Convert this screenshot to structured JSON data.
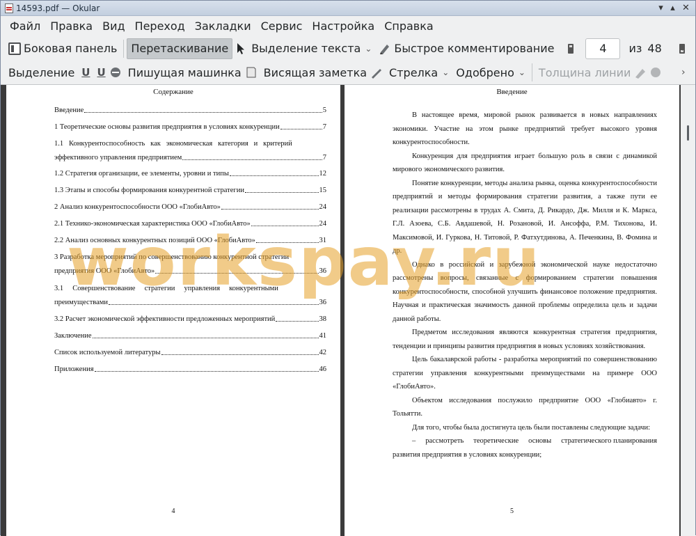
{
  "window": {
    "title": "14593.pdf  — Okular"
  },
  "menu": [
    "Файл",
    "Правка",
    "Вид",
    "Переход",
    "Закладки",
    "Сервис",
    "Настройка",
    "Справка"
  ],
  "toolbar1": {
    "sidebar": "Боковая панель",
    "drag": "Перетаскивание",
    "select_text": "Выделение текста",
    "quick_comment": "Быстрое комментирование",
    "current_page": "4",
    "of": "из",
    "total_pages": "48"
  },
  "toolbar2": {
    "highlight": "Выделение",
    "underline": "U",
    "squiggle": "U",
    "typewriter": "Пишущая машинка",
    "popup_note": "Висящая заметка",
    "arrow": "Стрелка",
    "approved": "Одобрено",
    "line_width": "Толщина линии"
  },
  "left_page": {
    "heading": "Содержание",
    "toc": [
      {
        "title": "Введение",
        "page": "5"
      },
      {
        "title": "1 Теоретические основы развития предприятия в условиях конкуренции",
        "page": "7"
      },
      {
        "title_l1": "1.1   Конкурентоспособность   как   экономическая   категория   и   критерий",
        "title_l2": "эффективного управления предприятием",
        "page": "7"
      },
      {
        "title": "1.2 Стратегия организации, ее элементы, уровни и типы",
        "page": "12"
      },
      {
        "title": "1.3 Этапы и способы формирования конкурентной стратегии",
        "page": "15"
      },
      {
        "title": "2 Анализ конкурентоспособности ООО «ГлобиАвто»",
        "page": "24"
      },
      {
        "title": "2.1 Технико-экономическая характеристика ООО «ГлобиАвто»",
        "page": "24"
      },
      {
        "title": "2.2 Анализ основных конкурентных позиций ООО «ГлобиАвто»",
        "page": "31"
      },
      {
        "title_l1": "3 Разработка мероприятий по совершенствованию конкурентной стратегии",
        "title_l2": "предприятия ООО «ГлобиАвто»",
        "page": "36"
      },
      {
        "title_l1": "3.1     Совершенствование     стратегии     управления     конкурентными",
        "title_l2": "преимуществами",
        "page": "36"
      },
      {
        "title": "3.2 Расчет экономической эффективности предложенных мероприятий",
        "page": "38"
      },
      {
        "title": "Заключение",
        "page": "41"
      },
      {
        "title": "Список используемой литературы",
        "page": "42"
      },
      {
        "title": "Приложения",
        "page": "46"
      }
    ],
    "page_number": "4"
  },
  "right_page": {
    "heading": "Введение",
    "paragraphs": [
      "В настоящее время, мировой рынок развивается в новых направлениях экономики. Участие на этом рынке предприятий требует высокого уровня конкурентоспособности.",
      "Конкуренция для предприятия играет большую роль в связи с динамикой мирового экономического развития.",
      "Понятие конкуренции, методы анализа рынка, оценка конкурентоспособности предприятий и методы формирования стратегии развития, а также пути ее реализации рассмотрены в трудах А. Смита, Д. Рикардо, Дж. Милля и К. Маркса, Г.Л. Азоева, С.Б. Авдашевой, Н. Розановой, И. Ансоффа, Р.М. Тихонова, И. Максимовой, И. Гуркова, Н. Титовой, Р. Фатхутдинова, А. Печенкина, В. Фомина и др.",
      "Однако в российской и зарубежной экономической науке недостаточно рассмотрены вопросы, связанные с формированием стратегии повышения конкурентоспособности, способной улучшить финансовое положение предприятия. Научная и практическая значимость данной проблемы определила цель и задачи данной работы.",
      "Предметом исследования являются конкурентная стратегия предприятия, тенденции и принципы развития предприятия в новых условиях хозяйствования.",
      "Цель бакалаврской работы - разработка мероприятий по совершенствованию стратегии управления конкурентными преимуществами на примере ООО «ГлобиАвто».",
      "Объектом исследования послужило предприятие ООО «Глобиавто» г. Тольятти.",
      "Для того, чтобы была достигнута цель были поставлены следующие задачи:",
      "–     рассмотреть     теоретические     основы     стратегического планирования развития предприятия в условиях конкуренции;"
    ],
    "page_number": "5"
  },
  "watermark": "workspay.ru"
}
